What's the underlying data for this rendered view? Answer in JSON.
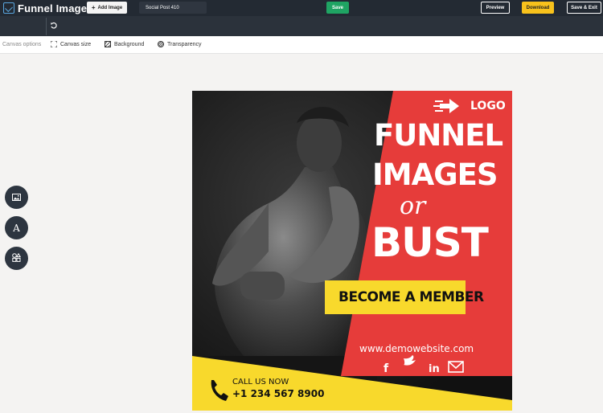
{
  "app": {
    "brand": "Funnel Images"
  },
  "toolbar": {
    "add_image_label": "Add Image",
    "document_name": "Social Post 410",
    "save_label": "Save",
    "preview_label": "Preview",
    "download_label": "Download",
    "save_exit_label": "Save & Exit"
  },
  "options": {
    "label": "Canvas options",
    "canvas_size": "Canvas size",
    "background": "Background",
    "transparency": "Transparency"
  },
  "side_tools": [
    {
      "icon": "image-icon"
    },
    {
      "icon": "text-icon"
    },
    {
      "icon": "shapes-icon"
    }
  ],
  "design": {
    "logo_text": "LOGO",
    "headline1": "FUNNEL",
    "headline2": "IMAGES",
    "connector": "or",
    "headline3": "BUST",
    "cta": "BECOME A MEMBER",
    "website": "www.demowebsite.com",
    "call_label": "CALL US NOW",
    "phone": "+1 234 567 8900",
    "colors": {
      "red": "#e63c3a",
      "yellow": "#f8d92c",
      "dark": "#1a1a1a"
    }
  }
}
